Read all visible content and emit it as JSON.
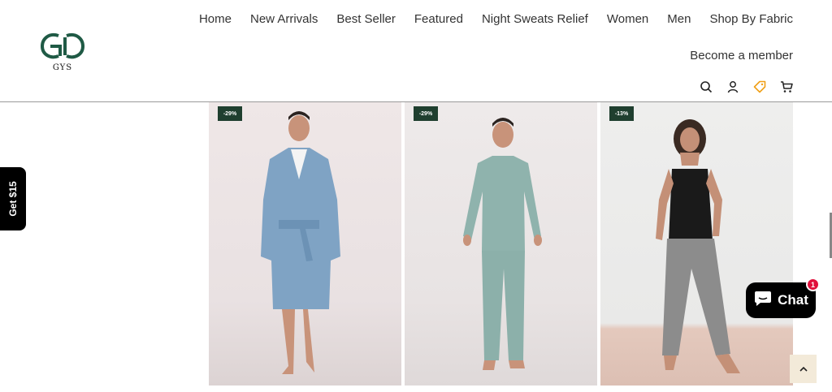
{
  "brand": {
    "name": "GYS",
    "color": "#1f5a45"
  },
  "nav": {
    "items": [
      "Home",
      "New Arrivals",
      "Best Seller",
      "Featured",
      "Night Sweats Relief",
      "Women",
      "Men",
      "Shop By Fabric"
    ],
    "member_link": "Become a member"
  },
  "header_icons": [
    "search-icon",
    "account-icon",
    "tag-icon",
    "cart-icon"
  ],
  "products": [
    {
      "badge": "-29%",
      "description": "man in light blue robe with white piping"
    },
    {
      "badge": "-29%",
      "description": "man in sage green long sleeve pajama set"
    },
    {
      "badge": "-13%",
      "description": "woman in black cami and grey pants"
    }
  ],
  "promo_tab": {
    "label": "Get $15"
  },
  "chat": {
    "label": "Chat",
    "unread": "1"
  },
  "colors": {
    "badge_bg": "#1f3f2f",
    "chat_badge": "#e0103b",
    "to_top_bg": "#f3ead9",
    "tag_icon": "#f0a018"
  }
}
